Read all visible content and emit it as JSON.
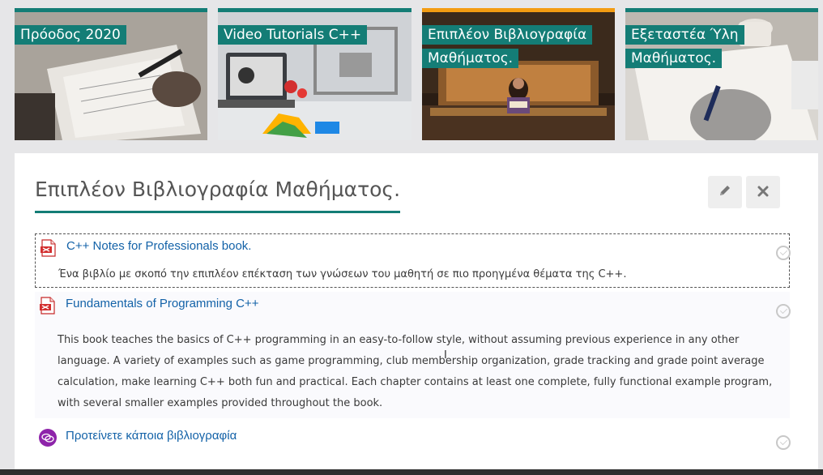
{
  "tiles": [
    {
      "title": "Πρόοδος 2020",
      "active": false
    },
    {
      "title": "Video Tutorials C++",
      "active": false
    },
    {
      "title": "Επιπλέον Βιβλιογραφία Μαθήματος.",
      "active": true
    },
    {
      "title": "Εξεταστέα Ύλη Μαθήματος.",
      "active": false
    }
  ],
  "panel": {
    "title": "Επιπλέον Βιβλιογραφία Μαθήματος.",
    "edit_icon": "pencil-icon",
    "close_icon": "close-icon",
    "items": [
      {
        "icon": "pdf-icon",
        "link": "C++ Notes for Professionals book.",
        "description": "Ένα βιβλίο με σκοπό την επιπλέον επέκταση των γνώσεων του μαθητή σε πιο προηγμένα θέματα της C++."
      },
      {
        "icon": "pdf-icon",
        "link": "Fundamentals of Programming C++",
        "description": "This book teaches the basics of C++ programming in an easy-to-follow style, without assuming previous experience in any other language. A variety of examples such as game programming, club membership organization, grade tracking and grade point average calculation, make learning C++ both fun and practical. Each chapter contains at least one complete, fully functional example program, with several smaller examples provided throughout the book."
      },
      {
        "icon": "forum-icon",
        "link": "Προτείνετε κάποια βιβλιογραφία",
        "description": ""
      }
    ]
  },
  "colors": {
    "accent": "#147d76",
    "active_tile": "#f39c12",
    "link": "#1362a8"
  }
}
